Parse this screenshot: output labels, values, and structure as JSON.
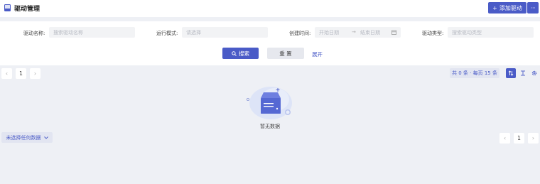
{
  "header": {
    "title": "驱动管理",
    "add_button": "添加驱动",
    "add_icon": "plus-icon",
    "more_label": "···"
  },
  "filters": {
    "driver_name_label": "驱动名称:",
    "driver_name_placeholder": "搜索驱动名称",
    "run_mode_label": "运行模式:",
    "run_mode_placeholder": "请选择",
    "created_time_label": "创建时间:",
    "start_date_placeholder": "开始日期",
    "end_date_placeholder": "结束日期",
    "driver_type_label": "驱动类型:",
    "driver_type_placeholder": "搜索驱动类型",
    "search_button": "搜索",
    "reset_button": "重 置",
    "expand_link": "展开"
  },
  "pagination_top": {
    "current_page": "1"
  },
  "summary": "共 0 条 · 每页 15 条",
  "empty": {
    "text": "暂无数据"
  },
  "bottom": {
    "selection_label": "未选择任何数据",
    "current_page": "1"
  },
  "colors": {
    "primary": "#4a5bc7",
    "background": "#eef0f5"
  }
}
